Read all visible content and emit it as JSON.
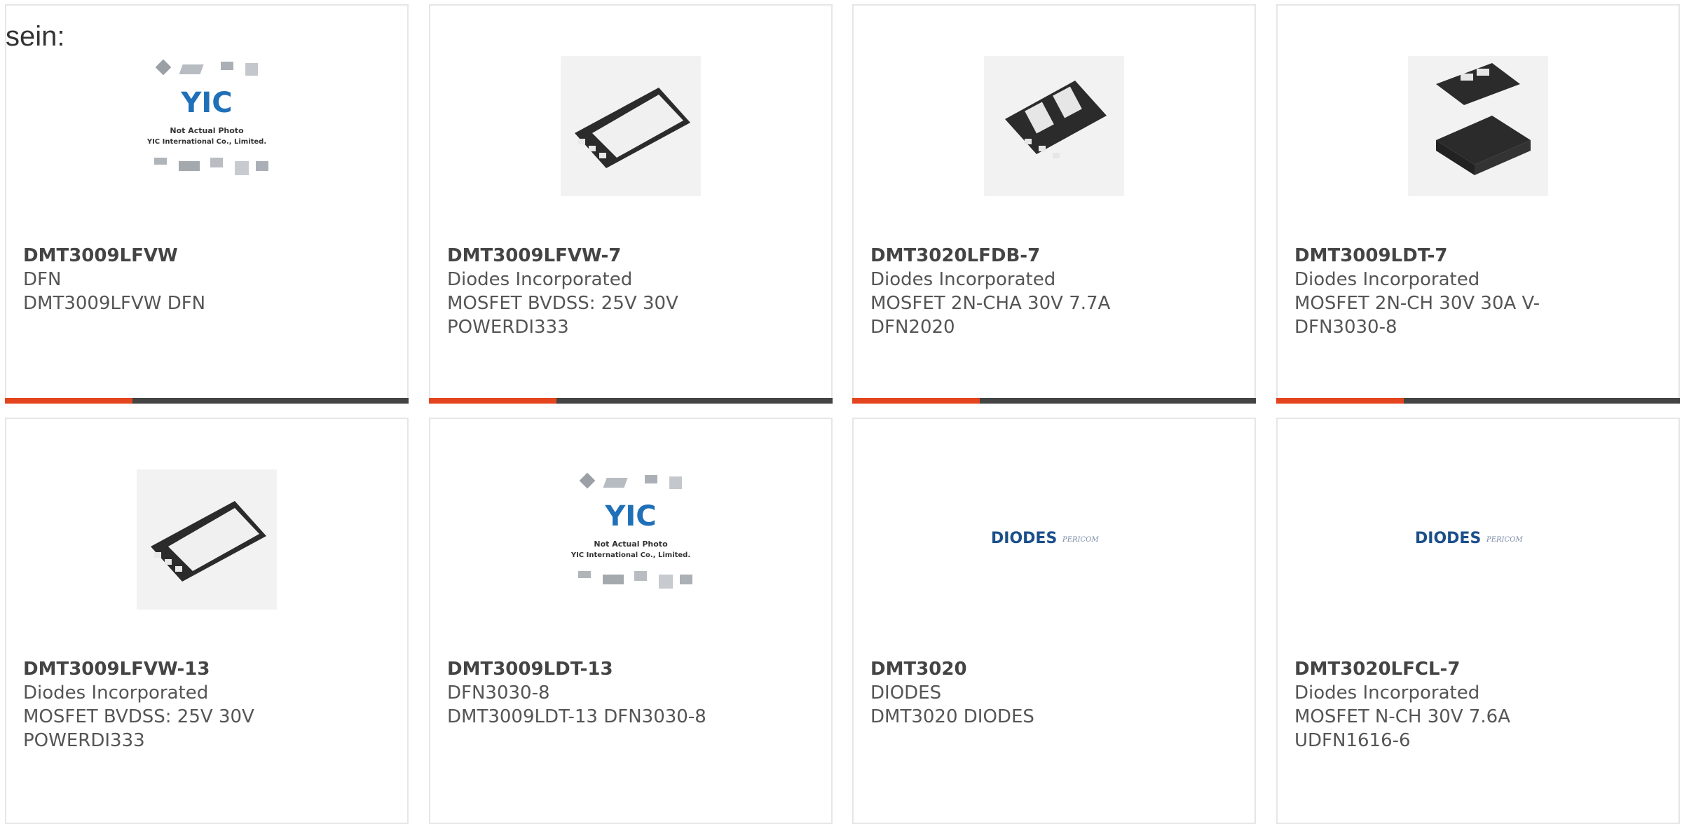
{
  "lead_text": "sein:",
  "colors": {
    "accent": "#e4451f",
    "bar": "#444444",
    "card_border": "#e6e6e6",
    "yic_blue": "#1f70b8"
  },
  "placeholder": {
    "line1": "Not Actual Photo",
    "line2": "YIC International Co., Limited."
  },
  "logos": {
    "diodes": "DIODES",
    "pericom": "PERICOM"
  },
  "products": [
    {
      "title": "DMT3009LFVW",
      "line1": "DFN",
      "line2": "DMT3009LFVW DFN",
      "line3": "",
      "image": "yic-placeholder"
    },
    {
      "title": "DMT3009LFVW-7",
      "line1": "Diodes Incorporated",
      "line2": "MOSFET BVDSS: 25V 30V",
      "line3": "POWERDI333",
      "image": "powerdi-package"
    },
    {
      "title": "DMT3020LFDB-7",
      "line1": "Diodes Incorporated",
      "line2": "MOSFET 2N-CHA 30V 7.7A",
      "line3": "DFN2020",
      "image": "dual-dfn-package"
    },
    {
      "title": "DMT3009LDT-7",
      "line1": "Diodes Incorporated",
      "line2": "MOSFET 2N-CH 30V 30A V-",
      "line3": "DFN3030-8",
      "image": "dfn3030-package"
    },
    {
      "title": "DMT3009LFVW-13",
      "line1": "Diodes Incorporated",
      "line2": "MOSFET BVDSS: 25V 30V",
      "line3": "POWERDI333",
      "image": "powerdi-package"
    },
    {
      "title": "DMT3009LDT-13",
      "line1": "DFN3030-8",
      "line2": "DMT3009LDT-13 DFN3030-8",
      "line3": "",
      "image": "yic-placeholder"
    },
    {
      "title": "DMT3020",
      "line1": "DIODES",
      "line2": "DMT3020 DIODES",
      "line3": "",
      "image": "diodes-pericom-logo"
    },
    {
      "title": "DMT3020LFCL-7",
      "line1": "Diodes Incorporated",
      "line2": "MOSFET N-CH 30V 7.6A",
      "line3": "UDFN1616-6",
      "image": "diodes-pericom-logo"
    }
  ]
}
